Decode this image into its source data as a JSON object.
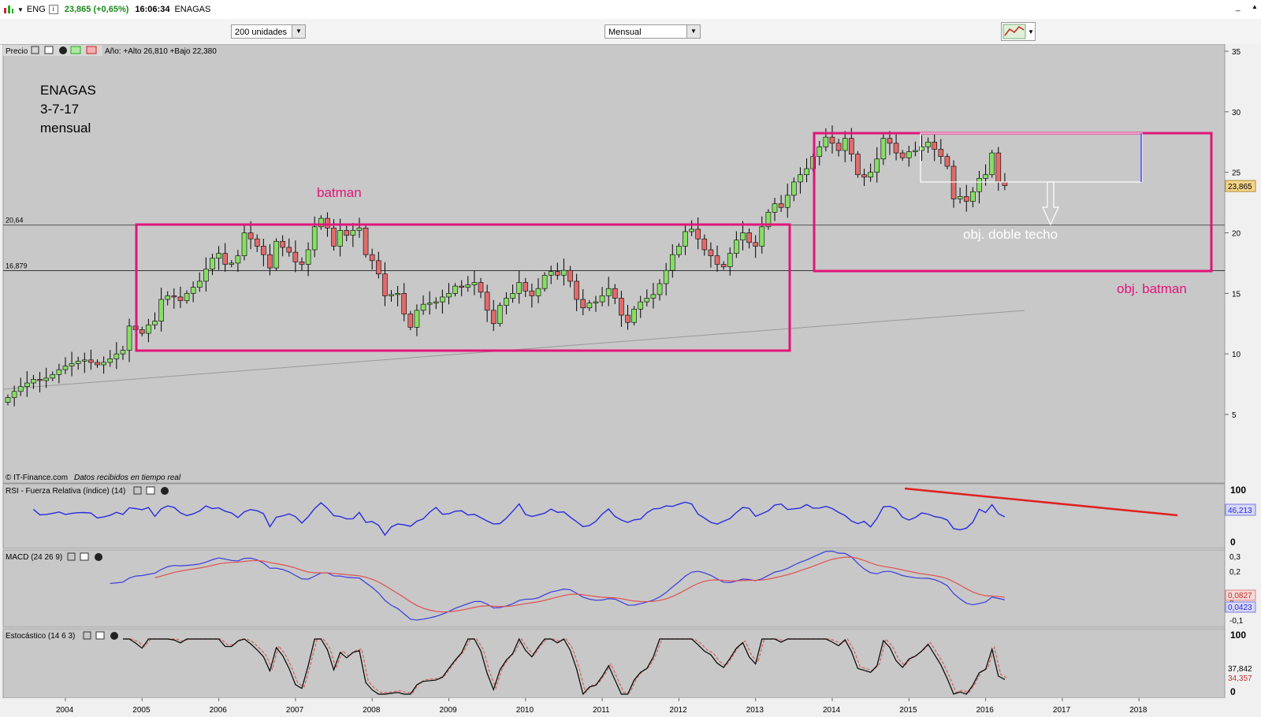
{
  "topbar": {
    "symbol": "ENG",
    "price": "23,865 (+0,65%)",
    "time": "16:06:34",
    "name": "ENAGAS"
  },
  "controls": {
    "units": "200 unidades",
    "period": "Mensual"
  },
  "price_panel": {
    "label": "Precio",
    "range": "Año: +Alto 26,810 +Bajo 22,380",
    "copyright": "© IT-Finance.com",
    "realtime": "Datos recibidos en tiempo real",
    "current_price_tag": "23,865",
    "hline1": "20,64",
    "hline2": "16,879"
  },
  "annotations": {
    "title_l1": "ENAGAS",
    "title_l2": "3-7-17",
    "title_l3": "mensual",
    "batman": "batman",
    "doble_techo": "obj. doble techo",
    "obj_batman": "obj. batman"
  },
  "rsi_panel": {
    "label": "RSI - Fuerza Relativa (índice) (14)",
    "value": "46,213",
    "top": "100",
    "bottom": "0"
  },
  "macd_panel": {
    "label": "MACD (24 26 9)",
    "v1": "0,0827",
    "v2": "0,0423"
  },
  "stoch_panel": {
    "label": "Estocástico (14 6 3)",
    "v1": "37,842",
    "v2": "34,357",
    "top": "100",
    "bottom": "0"
  },
  "colors": {
    "pink": "#e0157a",
    "up": "#88dd66",
    "down": "#e06b6b",
    "rsi": "#2a2ae0",
    "trend": "#e02020",
    "bg": "#c8c8c8"
  },
  "chart_data": [
    {
      "type": "candlestick",
      "title": "ENAGAS",
      "x_years": [
        "2004",
        "2005",
        "2006",
        "2007",
        "2008",
        "2009",
        "2010",
        "2011",
        "2012",
        "2013",
        "2014",
        "2015",
        "2016",
        "2017",
        "2018"
      ],
      "y_ticks": [
        5,
        10,
        15,
        20,
        25,
        30,
        35
      ],
      "ylim": [
        0,
        35
      ],
      "horizontal_lines": [
        20.64,
        16.879
      ],
      "last": 23.865,
      "series_close_approx": [
        6.4,
        6.9,
        7.3,
        7.6,
        7.9,
        7.8,
        8.0,
        8.3,
        8.7,
        9.0,
        9.2,
        9.4,
        9.5,
        9.3,
        9.1,
        9.3,
        9.6,
        10.0,
        10.3,
        12.3,
        12.0,
        11.7,
        12.4,
        12.7,
        14.5,
        14.8,
        14.7,
        14.4,
        15.0,
        15.5,
        16.0,
        17.0,
        17.9,
        18.3,
        17.4,
        17.5,
        18.1,
        20.0,
        19.5,
        18.9,
        18.2,
        17.1,
        19.3,
        18.8,
        18.4,
        17.6,
        17.4,
        18.6,
        20.5,
        21.2,
        20.4,
        18.9,
        20.2,
        19.8,
        20.2,
        20.4,
        18.2,
        17.7,
        16.6,
        14.8,
        14.9,
        15.0,
        13.3,
        12.2,
        13.6,
        14.1,
        14.2,
        14.3,
        14.7,
        15.0,
        15.6,
        15.5,
        15.7,
        15.9,
        15.1,
        13.6,
        12.5,
        14.0,
        14.6,
        15.0,
        15.9,
        15.2,
        14.8,
        15.4,
        16.5,
        16.8,
        16.5,
        16.9,
        16.0,
        14.5,
        13.8,
        14.2,
        14.3,
        14.8,
        15.4,
        14.6,
        13.2,
        12.6,
        13.7,
        14.3,
        14.6,
        14.9,
        15.8,
        16.9,
        18.2,
        18.9,
        20.1,
        20.3,
        19.5,
        18.6,
        18.1,
        17.4,
        17.2,
        18.3,
        19.4,
        20.0,
        19.2,
        18.9,
        20.5,
        21.7,
        22.4,
        22.1,
        23.1,
        24.2,
        24.8,
        25.3,
        26.3,
        27.1,
        27.9,
        27.4,
        26.8,
        27.8,
        26.5,
        24.8,
        24.6,
        25.0,
        26.1,
        27.8,
        27.4,
        26.6,
        26.2,
        26.7,
        26.8,
        27.1,
        27.5,
        26.9,
        26.3,
        25.5,
        22.8,
        23.0,
        22.6,
        23.4,
        24.5,
        24.8,
        26.6,
        24.2,
        23.9
      ],
      "rsi": {
        "last": 46.213,
        "range": [
          0,
          100
        ]
      },
      "macd": {
        "params": "24 26 9",
        "macd_last": 0.0423,
        "signal_last": 0.0827,
        "y_ticks": [
          -0.1,
          0,
          0.2,
          0.3
        ]
      },
      "stochastic": {
        "params": "14 6 3",
        "k_last": 37.842,
        "d_last": 34.357,
        "range": [
          0,
          100
        ]
      }
    }
  ]
}
